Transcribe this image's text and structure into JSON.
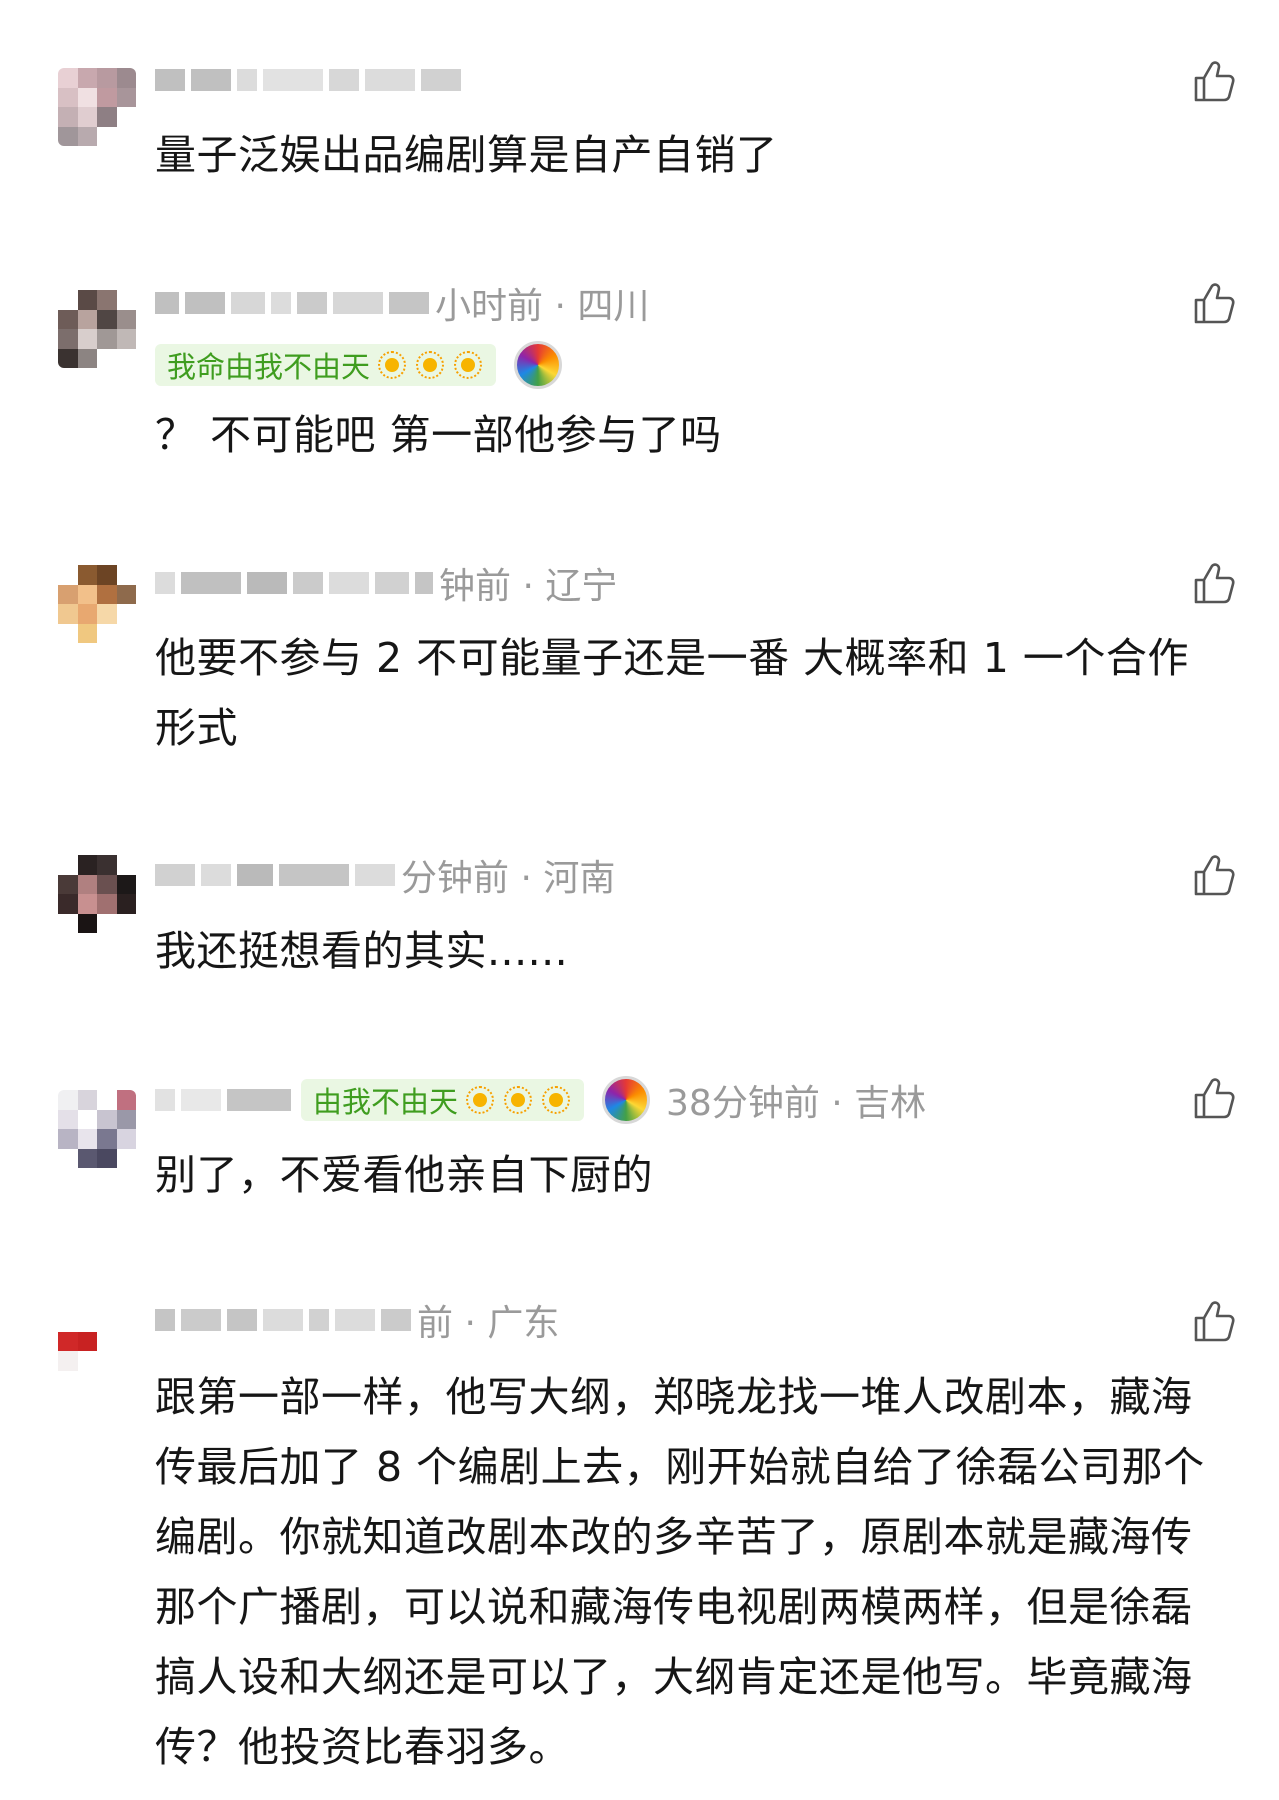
{
  "comments": [
    {
      "meta": "",
      "badge": "",
      "text": "量子泛娱出品编剧算是自产自销了",
      "like_icon": "thumbs-up-icon"
    },
    {
      "meta": "小时前 · 四川",
      "badge": "我命由我不由天",
      "text": "？ 不可能吧 第一部他参与了吗",
      "like_icon": "thumbs-up-icon"
    },
    {
      "meta": "钟前 · 辽宁",
      "badge": "",
      "text": "他要不参与 2 不可能量子还是一番 大概率和 1 一个合作形式",
      "like_icon": "thumbs-up-icon"
    },
    {
      "meta": "分钟前 · 河南",
      "badge": "",
      "text": "我还挺想看的其实......",
      "like_icon": "thumbs-up-icon"
    },
    {
      "meta": "38分钟前 · 吉林",
      "badge": "由我不由天",
      "text": "别了，不爱看他亲自下厨的",
      "like_icon": "thumbs-up-icon"
    },
    {
      "meta": "前 · 广东",
      "badge": "",
      "text": "跟第一部一样，他写大纲，郑晓龙找一堆人改剧本，藏海传最后加了 8 个编剧上去，刚开始就自给了徐磊公司那个编剧。你就知道改剧本改的多辛苦了，原剧本就是藏海传那个广播剧，可以说和藏海传电视剧两模两样，但是徐磊搞人设和大纲还是可以了，大纲肯定还是他写。毕竟藏海传？他投资比春羽多。",
      "like_icon": "thumbs-up-icon"
    }
  ]
}
